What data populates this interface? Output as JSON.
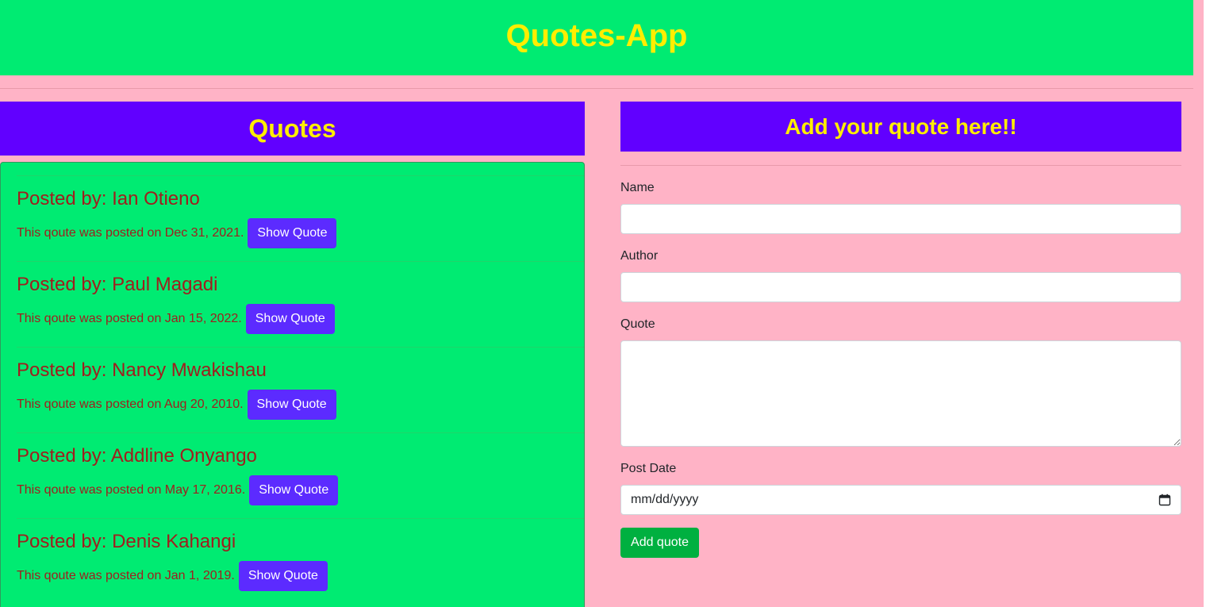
{
  "app": {
    "title": "Quotes-App"
  },
  "quotes_panel": {
    "heading": "Quotes",
    "items": [
      {
        "author": "Posted by: Ian Otieno",
        "date_text": "This qoute was posted on Dec 31, 2021.",
        "button_label": "Show Quote"
      },
      {
        "author": "Posted by: Paul Magadi",
        "date_text": "This qoute was posted on Jan 15, 2022.",
        "button_label": "Show Quote"
      },
      {
        "author": "Posted by: Nancy Mwakishau",
        "date_text": "This qoute was posted on Aug 20, 2010.",
        "button_label": "Show Quote"
      },
      {
        "author": "Posted by: Addline Onyango",
        "date_text": "This qoute was posted on May 17, 2016.",
        "button_label": "Show Quote"
      },
      {
        "author": "Posted by: Denis Kahangi",
        "date_text": "This qoute was posted on Jan 1, 2019.",
        "button_label": "Show Quote"
      }
    ]
  },
  "form": {
    "heading": "Add your quote here!!",
    "name_label": "Name",
    "name_value": "",
    "author_label": "Author",
    "author_value": "",
    "quote_label": "Quote",
    "quote_value": "",
    "date_label": "Post Date",
    "date_placeholder": "mm/dd/yyyy",
    "submit_label": "Add quote"
  },
  "colors": {
    "header_bg": "#00eb72",
    "title_text": "#ffee00",
    "panel_header_bg": "#6100ff",
    "page_bg": "#ffb3c6",
    "author_text": "#a01e1e",
    "show_button_bg": "#5c2bff",
    "submit_button_bg": "#00b040"
  },
  "icons": {
    "date_picker": "calendar-icon"
  }
}
